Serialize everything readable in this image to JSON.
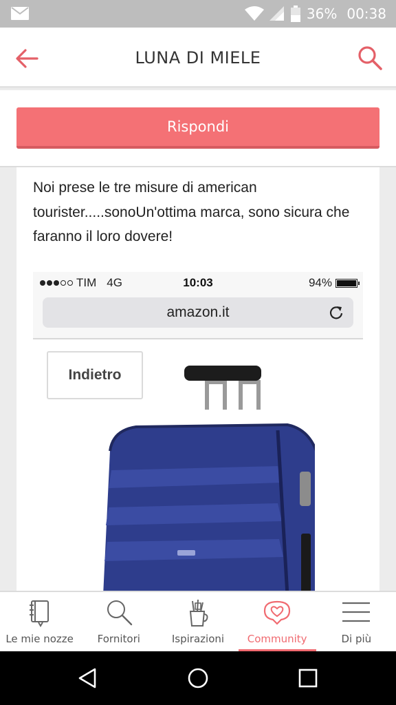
{
  "status_bar": {
    "battery": "36%",
    "time": "00:38",
    "icons": [
      "gmail-icon",
      "wifi-icon",
      "signal-icon",
      "battery-icon"
    ]
  },
  "app_bar": {
    "title": "LUNA DI MIELE",
    "back_icon": "arrow-left-icon",
    "search_icon": "search-icon",
    "accent_color": "#e46068"
  },
  "reply_button": {
    "label": "Rispondi",
    "color": "#f47175"
  },
  "post": {
    "text": "Noi prese le tre misure di american tourister.....sonoUn'ottima marca, sono sicura che faranno il loro dovere!",
    "screenshot": {
      "carrier": "TIM",
      "network": "4G",
      "time": "10:03",
      "battery": "94%",
      "url": "amazon.it",
      "back_button": "Indietro",
      "product_color": "#2e3d8c"
    }
  },
  "bottom_nav": {
    "items": [
      {
        "label": "Le mie nozze",
        "icon": "notebook-icon",
        "active": false
      },
      {
        "label": "Fornitori",
        "icon": "search-icon",
        "active": false
      },
      {
        "label": "Ispirazioni",
        "icon": "pencil-cup-icon",
        "active": false
      },
      {
        "label": "Community",
        "icon": "heart-chat-icon",
        "active": true
      },
      {
        "label": "Di più",
        "icon": "menu-icon",
        "active": false
      }
    ]
  },
  "system_nav": {
    "icons": [
      "back-triangle-icon",
      "home-circle-icon",
      "recents-square-icon"
    ]
  }
}
